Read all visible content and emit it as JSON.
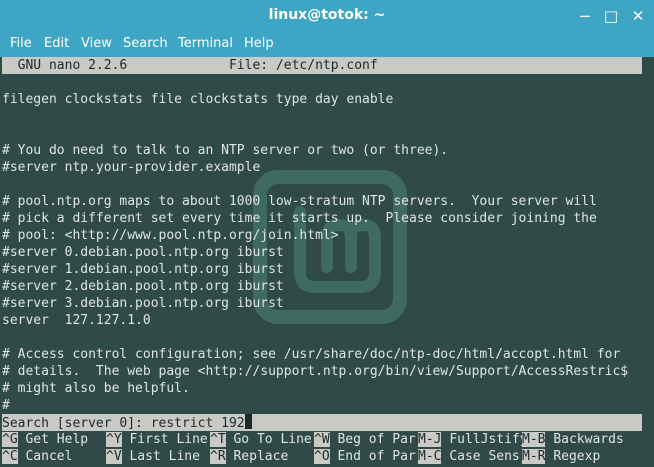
{
  "window": {
    "title": "linux@totok: ~",
    "controls": {
      "minimize": "−",
      "maximize": "□",
      "close": "✕"
    }
  },
  "menu": [
    "File",
    "Edit",
    "View",
    "Search",
    "Terminal",
    "Help"
  ],
  "nano": {
    "header": "  GNU nano 2.2.6             File: /etc/ntp.conf",
    "lines": [
      "filegen clockstats file clockstats type day enable",
      "",
      "",
      "# You do need to talk to an NTP server or two (or three).",
      "#server ntp.your-provider.example",
      "",
      "# pool.ntp.org maps to about 1000 low-stratum NTP servers.  Your server will",
      "# pick a different set every time it starts up.  Please consider joining the",
      "# pool: <http://www.pool.ntp.org/join.html>",
      "#server 0.debian.pool.ntp.org iburst",
      "#server 1.debian.pool.ntp.org iburst",
      "#server 2.debian.pool.ntp.org iburst",
      "#server 3.debian.pool.ntp.org iburst",
      "server  127.127.1.0",
      "",
      "# Access control configuration; see /usr/share/doc/ntp-doc/html/accopt.html for",
      "# details.  The web page <http://support.ntp.org/bin/view/Support/AccessRestric$",
      "# might also be helpful.",
      "#"
    ],
    "search_prompt": "Search [server 0]: restrict 192",
    "shortcuts_row1": [
      {
        "key": "^G",
        "label": "Get Help"
      },
      {
        "key": "^Y",
        "label": "First Line"
      },
      {
        "key": "^T",
        "label": "Go To Line"
      },
      {
        "key": "^W",
        "label": "Beg of Par"
      },
      {
        "key": "M-J",
        "label": "FullJstify"
      },
      {
        "key": "M-B",
        "label": "Backwards"
      }
    ],
    "shortcuts_row2": [
      {
        "key": "^C",
        "label": "Cancel"
      },
      {
        "key": "^V",
        "label": "Last Line"
      },
      {
        "key": "^R",
        "label": "Replace"
      },
      {
        "key": "^O",
        "label": "End of Par"
      },
      {
        "key": "M-C",
        "label": "Case Sens"
      },
      {
        "key": "M-R",
        "label": "Regexp"
      }
    ]
  },
  "colors": {
    "titlebar": "#3ea6c4",
    "terminal_bg": "#2f4a47",
    "highlight_bar": "#c9c9c6"
  },
  "icons": {
    "background_logo": "linux-mint-logo-icon"
  }
}
